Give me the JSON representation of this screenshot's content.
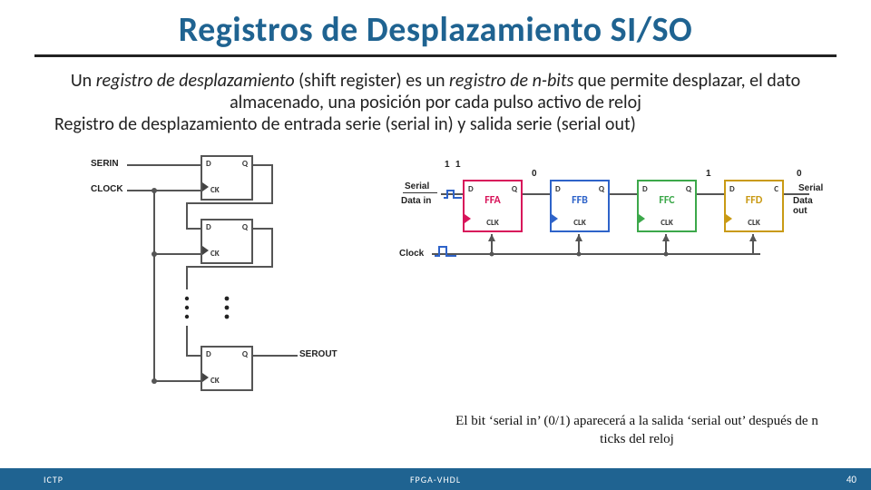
{
  "title": "Registros de Desplazamiento SI/SO",
  "para": {
    "pre": "Un ",
    "ital1": "registro de desplazamiento",
    "mid1": " (shift register) es un ",
    "ital2": "registro de n-bits",
    "mid2": " que permite desplazar, el dato almacenado, una posición por cada pulso activo de reloj"
  },
  "subline": "Registro de desplazamiento de entrada serie (serial in) y salida serie (serial out)",
  "left": {
    "serin": "SERIN",
    "clock": "CLOCK",
    "serout": "SEROUT",
    "pinD": "D",
    "pinQ": "Q",
    "pinCK": "CK"
  },
  "right": {
    "serial": "Serial",
    "datain": "Data in",
    "serout_lbl1": "Serial",
    "serout_lbl2": "Data out",
    "clock": "Clock",
    "pinD": "D",
    "pinQ": "Q",
    "pinC": "C",
    "clk": "CLK",
    "names": [
      "FFA",
      "FFB",
      "FFC",
      "FFD"
    ],
    "colors": [
      "#D8145A",
      "#2E63C9",
      "#3CA84A",
      "#C99A14"
    ],
    "bits_top": [
      "1",
      "1",
      "0",
      "",
      "1"
    ],
    "q_out": "0"
  },
  "caption": "El bit ‘serial in’ (0/1) aparecerá a la salida ‘serial out’ después de n ticks del reloj",
  "footer": {
    "left": "ICTP",
    "center": "FPGA-VHDL",
    "right": "40"
  }
}
